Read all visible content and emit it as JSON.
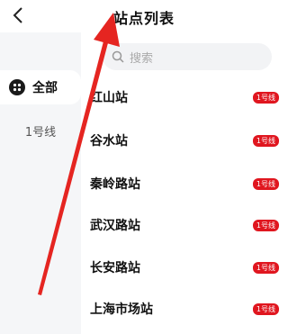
{
  "header": {
    "title": "站点列表"
  },
  "sidebar": {
    "all_label": "全部",
    "items": [
      {
        "label": "1号线"
      }
    ]
  },
  "search": {
    "placeholder": "搜索"
  },
  "stations": [
    {
      "name": "红山站",
      "line": "1号线"
    },
    {
      "name": "谷水站",
      "line": "1号线"
    },
    {
      "name": "秦岭路站",
      "line": "1号线"
    },
    {
      "name": "武汉路站",
      "line": "1号线"
    },
    {
      "name": "长安路站",
      "line": "1号线"
    },
    {
      "name": "上海市场站",
      "line": "1号线"
    }
  ],
  "colors": {
    "accent": "#e0161f",
    "sidebar_bg": "#f5f6f8",
    "annotation_arrow": "#e52521"
  }
}
